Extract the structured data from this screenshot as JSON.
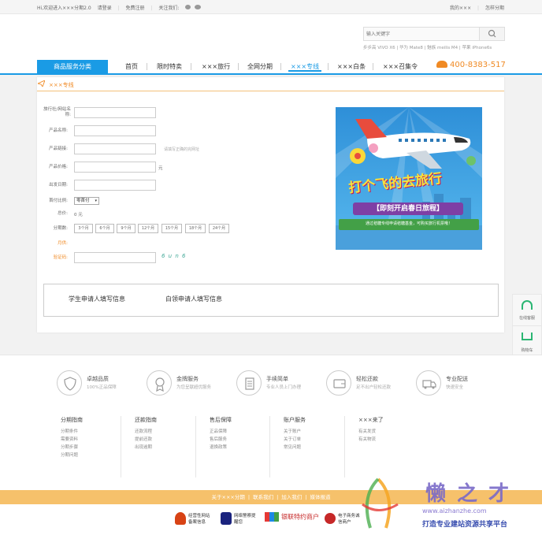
{
  "topbar": {
    "welcome": "Hi,欢迎进入×××分期2.0",
    "login": "请登录",
    "register": "免费注册",
    "follow": "关注我们:",
    "my": "我的×××",
    "how": "怎样分期"
  },
  "search": {
    "placeholder": "输入关键字",
    "hotwords": "步步高 VIVO X6 | 华为 Mate8 | 魅族 meilis M4 | 苹果 iPhone6s"
  },
  "nav": {
    "category": "商品服务分类",
    "items": [
      "首页",
      "限时特卖",
      "×××旅行",
      "全网分期",
      "×××专线",
      "×××白条",
      "×××召集令"
    ],
    "phone": "400-8383-517"
  },
  "panel": {
    "title": "×××专线"
  },
  "form": {
    "labels": {
      "agency": "旅行社/网站名称:",
      "product_name": "产品名称:",
      "product_link": "产品链接:",
      "product_price": "产品价格:",
      "depart_date": "出发日期:",
      "down_ratio": "首付比例:",
      "total": "总价:",
      "periods": "分期数:",
      "monthly": "月供:",
      "captcha": "验证码:"
    },
    "link_hint": "请填写正确的完网址",
    "price_unit": "元",
    "down_select": "零首付",
    "total_value": "0 元",
    "period_options": [
      "3个月",
      "6个月",
      "9个月",
      "12个月",
      "15个月",
      "18个月",
      "24个月"
    ],
    "captcha_text": "6 u n 6"
  },
  "apply": {
    "student": "学生申请人填写信息",
    "white": "白领申请人填写信息"
  },
  "banner": {
    "main": "打个飞的去旅行",
    "sub": "【即刻开启春日旅程】",
    "note": "通过秸糖专线申请秸糖基金，可购买旅行机票哦！"
  },
  "features": [
    {
      "title": "卓越品质",
      "sub": "100%正品保障",
      "icon": "shield-icon"
    },
    {
      "title": "金牌服务",
      "sub": "为您呈献超优服务",
      "icon": "medal-icon"
    },
    {
      "title": "手续简单",
      "sub": "专业人员上门办理",
      "icon": "clipboard-icon"
    },
    {
      "title": "轻松还款",
      "sub": "足不出户轻松还款",
      "icon": "wallet-icon"
    },
    {
      "title": "专业配送",
      "sub": "快速安全",
      "icon": "truck-icon"
    }
  ],
  "footer_cols": [
    {
      "title": "分期指南",
      "links": [
        "分期条件",
        "需要资料",
        "分期步骤",
        "分期问题"
      ]
    },
    {
      "title": "还款指南",
      "links": [
        "还款流程",
        "提前还款",
        "出现逾期"
      ]
    },
    {
      "title": "售后保障",
      "links": [
        "正品保障",
        "售后服务",
        "退换政策"
      ]
    },
    {
      "title": "账户服务",
      "links": [
        "关于账户",
        "关于订单",
        "常见问题"
      ]
    },
    {
      "title": "×××来了",
      "links": [
        "有关发货",
        "有关物流"
      ]
    }
  ],
  "footbar": [
    "关于×××分期",
    "联系我们",
    "加入我们",
    "媒体报道"
  ],
  "certs": [
    "经营性网站备案信息",
    "网络警察提醒您",
    "银联特约商户",
    "电子商务诚信商户"
  ],
  "sidebar": {
    "service": "在线客服",
    "cart": "购物车"
  },
  "watermark": {
    "logo": "懒之才",
    "url": "www.aizhanzhe.com",
    "slogan": "打造专业建站资源共享平台"
  },
  "colors": {
    "accent": "#1a9be5",
    "orange": "#f08a24",
    "footbar": "#f6c16b"
  }
}
